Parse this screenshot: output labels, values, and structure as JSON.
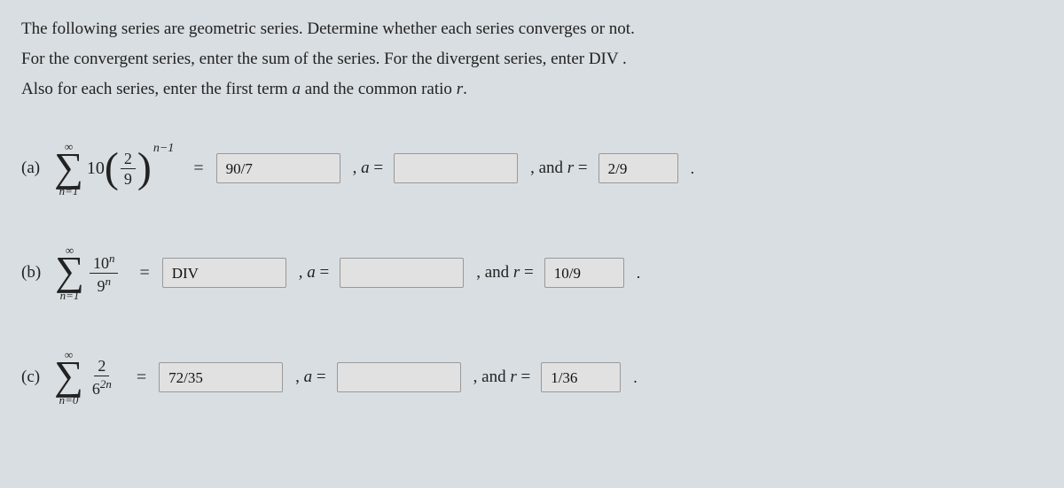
{
  "instructions": {
    "line1": "The following series are geometric series. Determine whether each series converges or not.",
    "line2_a": "For the convergent series, enter the sum of the series. For the divergent series, enter DIV .",
    "line3_a": "Also for each series, enter the first term ",
    "line3_b": " and the common ratio ",
    "line3_c": "."
  },
  "var_a": "a",
  "var_r": "r",
  "problems": [
    {
      "label": "(a)",
      "sigma_top": "∞",
      "sigma_bot": "n=1",
      "coef": "10",
      "frac_num": "2",
      "frac_den": "9",
      "exp": "n−1",
      "sum": "90/7",
      "a_val": "",
      "r_val": "2/9"
    },
    {
      "label": "(b)",
      "sigma_top": "∞",
      "sigma_bot": "n=1",
      "frac_num": "10ⁿ",
      "frac_den": "9ⁿ",
      "sum": "DIV",
      "a_val": "",
      "r_val": "10/9"
    },
    {
      "label": "(c)",
      "sigma_top": "∞",
      "sigma_bot": "n=0",
      "frac_num": "2",
      "frac_den": "6²ⁿ",
      "sum": "72/35",
      "a_val": "",
      "r_val": "1/36"
    }
  ],
  "labels": {
    "a_eq": ", a =",
    "r_eq": ", and r ="
  }
}
